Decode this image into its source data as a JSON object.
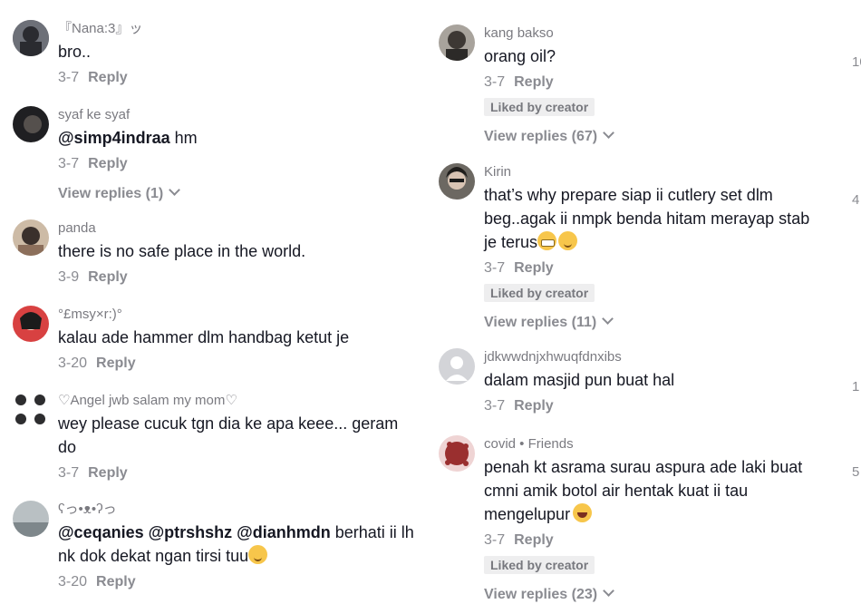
{
  "left_comments": [
    {
      "user": "『Nana:3』ッ",
      "text": "bro..",
      "date": "3-7",
      "reply": "Reply",
      "avatar_color": "#4b4e55"
    },
    {
      "user": "syaf ke syaf",
      "mention": "@simp4indraa",
      "text": " hm",
      "date": "3-7",
      "reply": "Reply",
      "view_replies": "View replies (1)",
      "avatar_color": "#2b2b2d"
    },
    {
      "user": "panda",
      "text": "there is no safe place in the world.",
      "date": "3-9",
      "reply": "Reply",
      "avatar_color": "#a58f79"
    },
    {
      "user": "°£msy×r:)°",
      "text": "kalau ade hammer dlm handbag ketut je",
      "date": "3-20",
      "reply": "Reply",
      "avatar_color": "#b52e2e"
    },
    {
      "user": "♡Angel jwb salam my mom♡",
      "text": "wey please cucuk tgn dia ke apa keee... geram",
      "text2": "do",
      "date": "3-7",
      "reply": "Reply",
      "avatar_color": "#6e6e74"
    },
    {
      "user": "ʕっ•ᴥ•ʔっ",
      "mentions": "@ceqanies @ptrshshz @dianhmdn",
      "text": " berhati ii lh",
      "text2": "nk dok dekat ngan tirsi tuu",
      "date": "3-20",
      "reply": "Reply",
      "avatar_color": "#9aa2a8"
    }
  ],
  "right_comments": [
    {
      "user": "kang bakso",
      "text": "orang oil?",
      "date": "3-7",
      "reply": "Reply",
      "liked": "Liked by creator",
      "view_replies": "View replies (67)",
      "avatar_color": "#4e4b46"
    },
    {
      "user": "Kirin",
      "text": "that’s why prepare siap ii cutlery set dlm",
      "text2": "beg..agak ii nmpk benda hitam merayap stab",
      "text3": "je terus",
      "date": "3-7",
      "reply": "Reply",
      "liked": "Liked by creator",
      "view_replies": "View replies (11)",
      "avatar_color": "#3b3a38"
    },
    {
      "user": "jdkwwdnjxhwuqfdnxibs",
      "text": "dalam masjid pun buat hal",
      "date": "3-7",
      "reply": "Reply",
      "avatar_color": "#d3d4d8"
    },
    {
      "user": "covid • Friends",
      "text": "penah kt asrama surau aspura ade laki buat",
      "text2": "cmni amik botol air hentak kuat ii tau",
      "text3": "mengelupur",
      "date": "3-7",
      "reply": "Reply",
      "liked": "Liked by creator",
      "view_replies": "View replies (23)",
      "avatar_color": "#8d2a2a"
    }
  ],
  "edge_fragments": [
    "10",
    "4",
    "1",
    "5"
  ]
}
